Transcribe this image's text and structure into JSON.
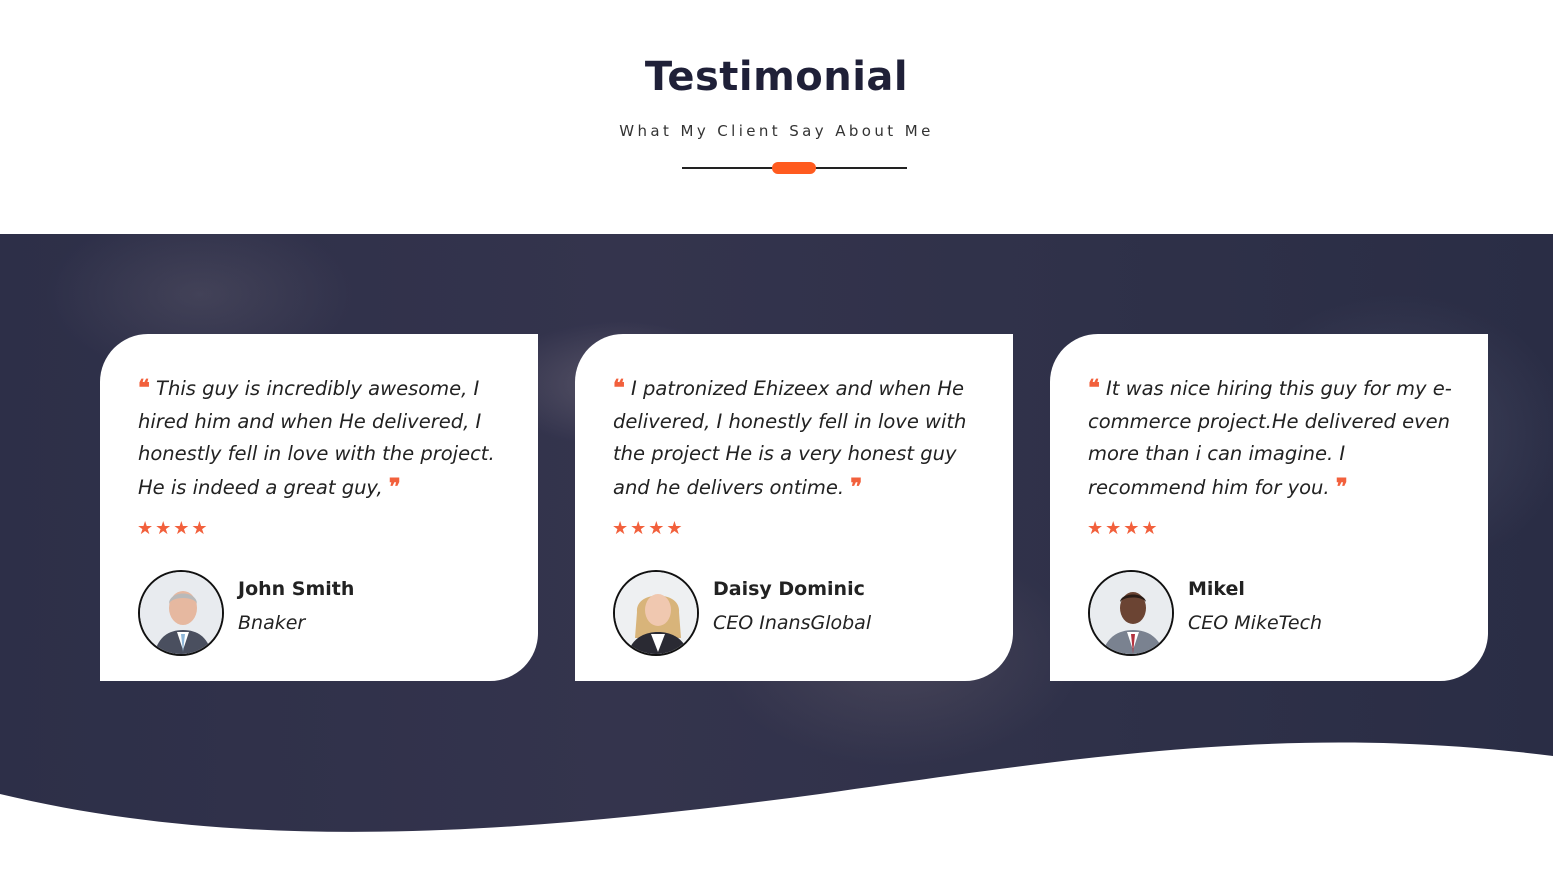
{
  "section": {
    "title": "Testimonial",
    "subtitle": "What My Client Say About Me"
  },
  "colors": {
    "accent": "#f2603c",
    "heading": "#1f2038",
    "band": "#2f3149"
  },
  "testimonials": [
    {
      "quote": "This guy is incredibly awesome, I hired him and when He delivered, I honestly fell in love with the project. He is indeed a great guy,",
      "stars": "★★★★",
      "rating": 4,
      "name": "John Smith",
      "role": "Bnaker",
      "avatar_icon": "avatar-man-grey-hair"
    },
    {
      "quote": "I patronized Ehizeex and when He delivered, I honestly fell in love with the project He is a very honest guy and he delivers ontime.",
      "stars": "★★★★",
      "rating": 4,
      "name": "Daisy Dominic",
      "role": "CEO InansGlobal",
      "avatar_icon": "avatar-woman-blonde"
    },
    {
      "quote": "It was nice hiring this guy for my e-commerce project.He delivered even more than i can imagine. I recommend him for you.",
      "stars": "★★★★",
      "rating": 4,
      "name": "Mikel",
      "role": "CEO MikeTech",
      "avatar_icon": "avatar-man-suit"
    }
  ],
  "quote_marks": {
    "open": "❝",
    "close": "❞"
  }
}
